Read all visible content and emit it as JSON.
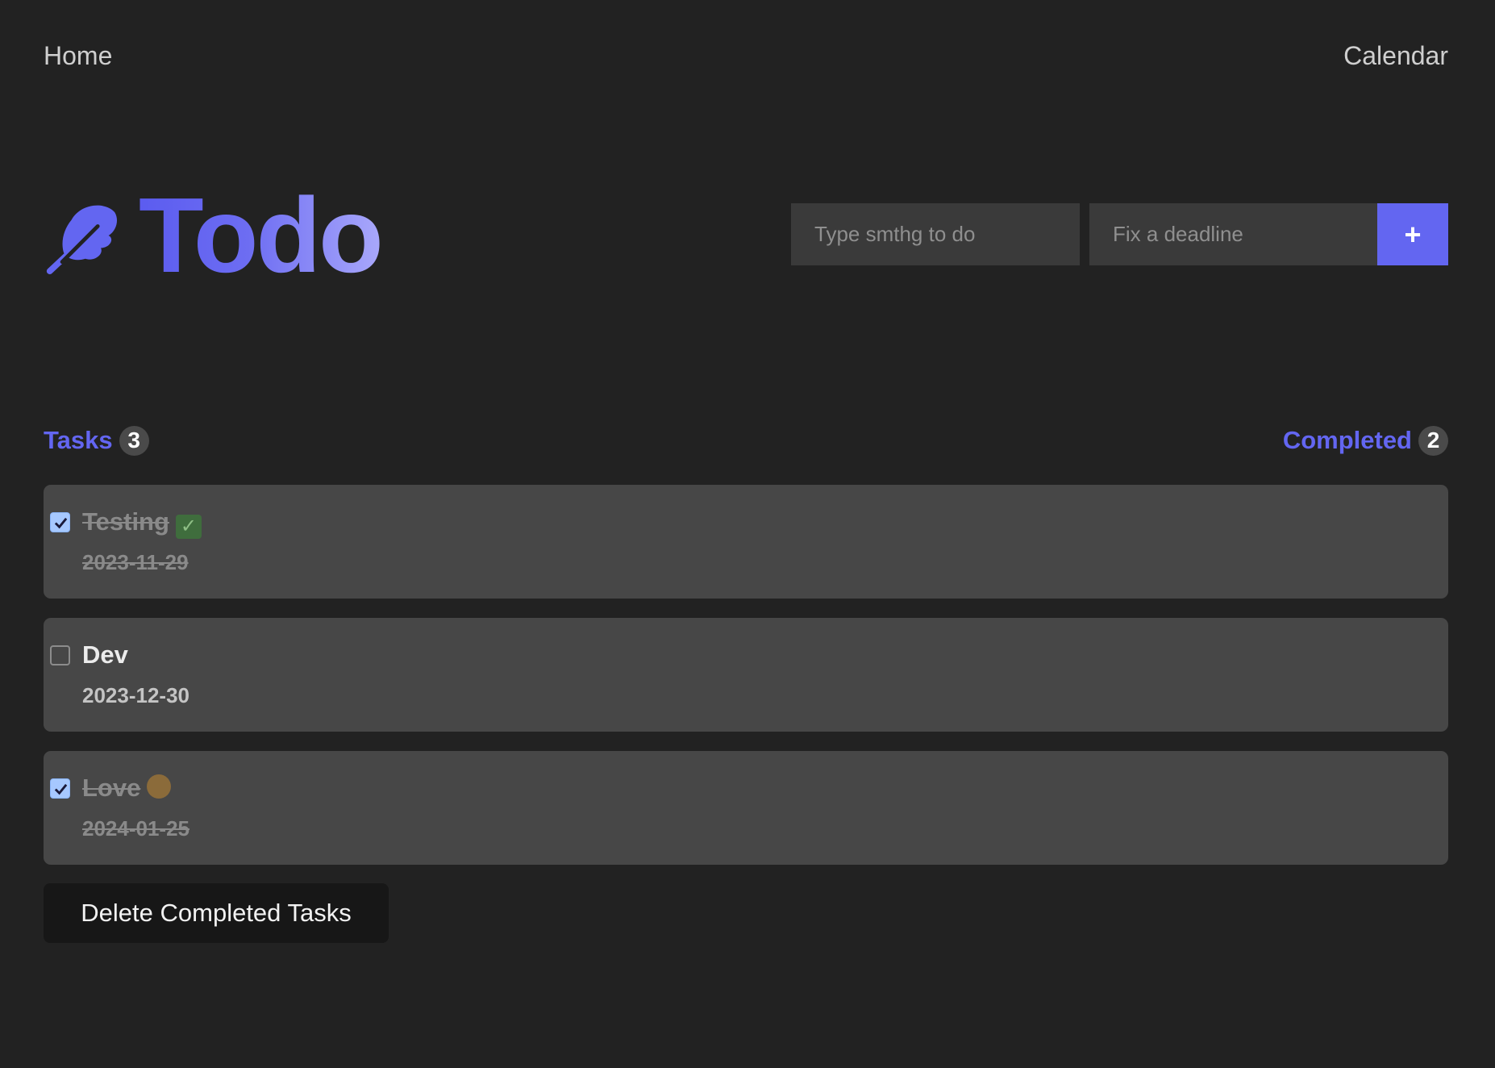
{
  "nav": {
    "home_label": "Home",
    "calendar_label": "Calendar"
  },
  "header": {
    "title": "Todo",
    "logo_icon": "feather-icon",
    "accent_color": "#6366f1"
  },
  "add_form": {
    "task_placeholder": "Type smthg to do",
    "deadline_placeholder": "Fix a deadline",
    "add_label": "+"
  },
  "counters": {
    "tasks_label": "Tasks",
    "tasks_count": "3",
    "completed_label": "Completed",
    "completed_count": "2"
  },
  "tasks": [
    {
      "title": "Testing",
      "emoji": "check-mark-button-icon",
      "date": "2023-11-29",
      "completed": true
    },
    {
      "title": "Dev",
      "emoji": "",
      "date": "2023-12-30",
      "completed": false
    },
    {
      "title": "Love",
      "emoji": "smiling-face-with-heart-eyes-icon",
      "date": "2024-01-25",
      "completed": true
    }
  ],
  "actions": {
    "delete_completed_label": "Delete Completed Tasks"
  }
}
